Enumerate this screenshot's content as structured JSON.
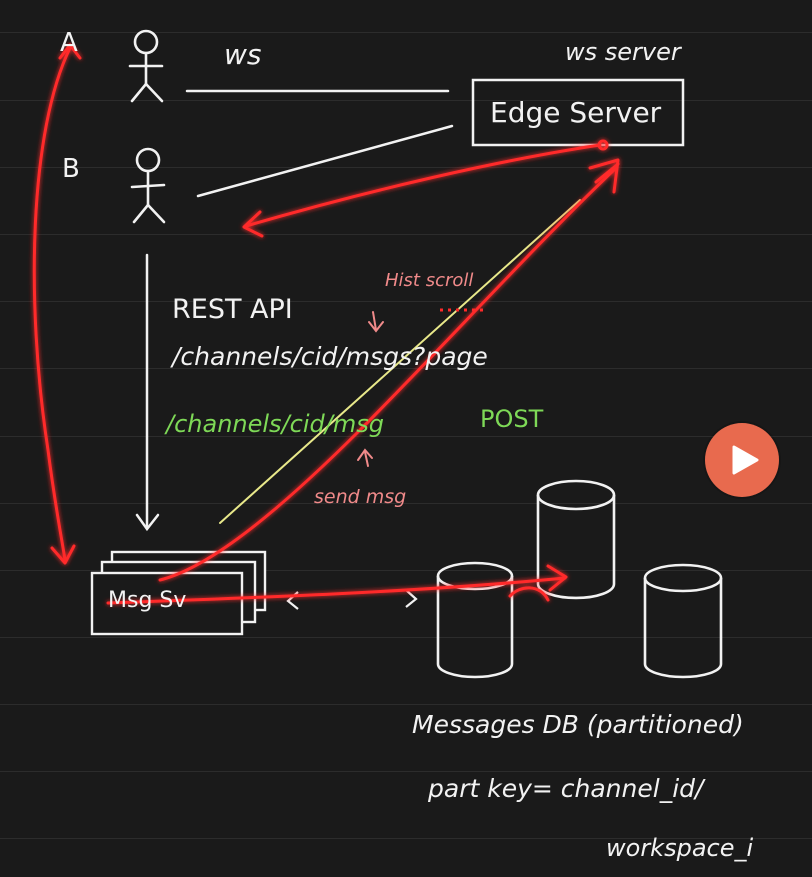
{
  "colors": {
    "background": "#1a1a1a",
    "chalk": "#f2f2f2",
    "red": "#ff2a2a",
    "green": "#7ed957",
    "pink": "#f08a8a",
    "yellow": "#e8e88a",
    "play": "#e86a4e"
  },
  "users": {
    "a_label": "A",
    "b_label": "B"
  },
  "connection": {
    "ws_label": "ws",
    "ws_server_label": "ws server",
    "edge_server_label": "Edge Server"
  },
  "api": {
    "rest_label": "REST API",
    "get_path": "/channels/cid/msgs?page",
    "hist_scroll_label": "Hist scroll",
    "post_path": "/channels/cid/msg",
    "post_method": "POST",
    "send_msg_label": "send msg"
  },
  "service": {
    "label": "Msg Sv"
  },
  "database": {
    "title": "Messages DB (partitioned)",
    "part_key_line1": "part key= channel_id/",
    "part_key_line2": "workspace_i"
  },
  "player": {
    "icon": "play-icon"
  }
}
